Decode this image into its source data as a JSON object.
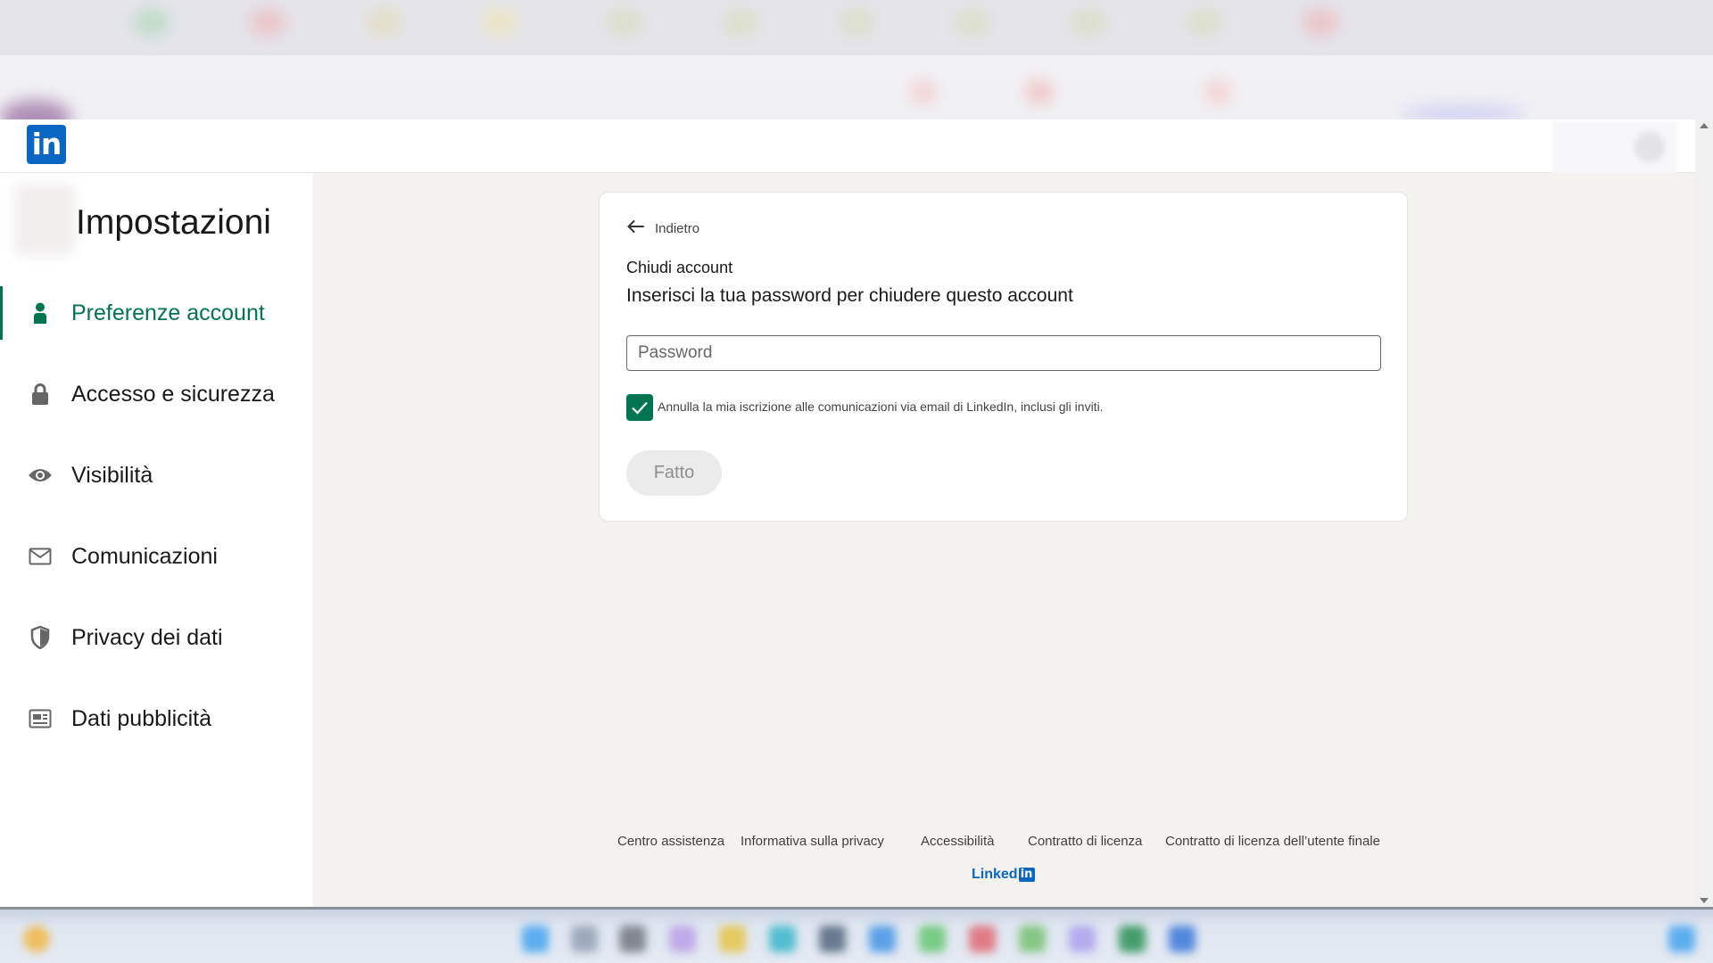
{
  "app": {
    "logo_text": "in"
  },
  "sidebar": {
    "title": "Impostazioni",
    "items": [
      {
        "label": "Preferenze account",
        "icon": "person-icon",
        "active": true
      },
      {
        "label": "Accesso e sicurezza",
        "icon": "lock-icon",
        "active": false
      },
      {
        "label": "Visibilità",
        "icon": "eye-icon",
        "active": false
      },
      {
        "label": "Comunicazioni",
        "icon": "envelope-icon",
        "active": false
      },
      {
        "label": "Privacy dei dati",
        "icon": "shield-icon",
        "active": false
      },
      {
        "label": "Dati pubblicità",
        "icon": "newspaper-icon",
        "active": false
      }
    ]
  },
  "card": {
    "back_label": "Indietro",
    "title": "Chiudi account",
    "subtitle": "Inserisci la tua password per chiudere questo account",
    "password_placeholder": "Password",
    "password_value": "",
    "checkbox_checked": true,
    "checkbox_label": "Annulla la mia iscrizione alle comunicazioni via email di LinkedIn, inclusi gli inviti.",
    "submit_label": "Fatto"
  },
  "footer": {
    "links": [
      "Centro assistenza",
      "Informativa sulla privacy",
      "Accessibilità",
      "Contratto di licenza",
      "Contratto di licenza dell’utente finale"
    ],
    "brand_word": "Linked",
    "brand_box": "in"
  },
  "colors": {
    "accent_green": "#01754f",
    "brand_blue": "#0a66c2",
    "page_bg": "#f4f2ee"
  }
}
